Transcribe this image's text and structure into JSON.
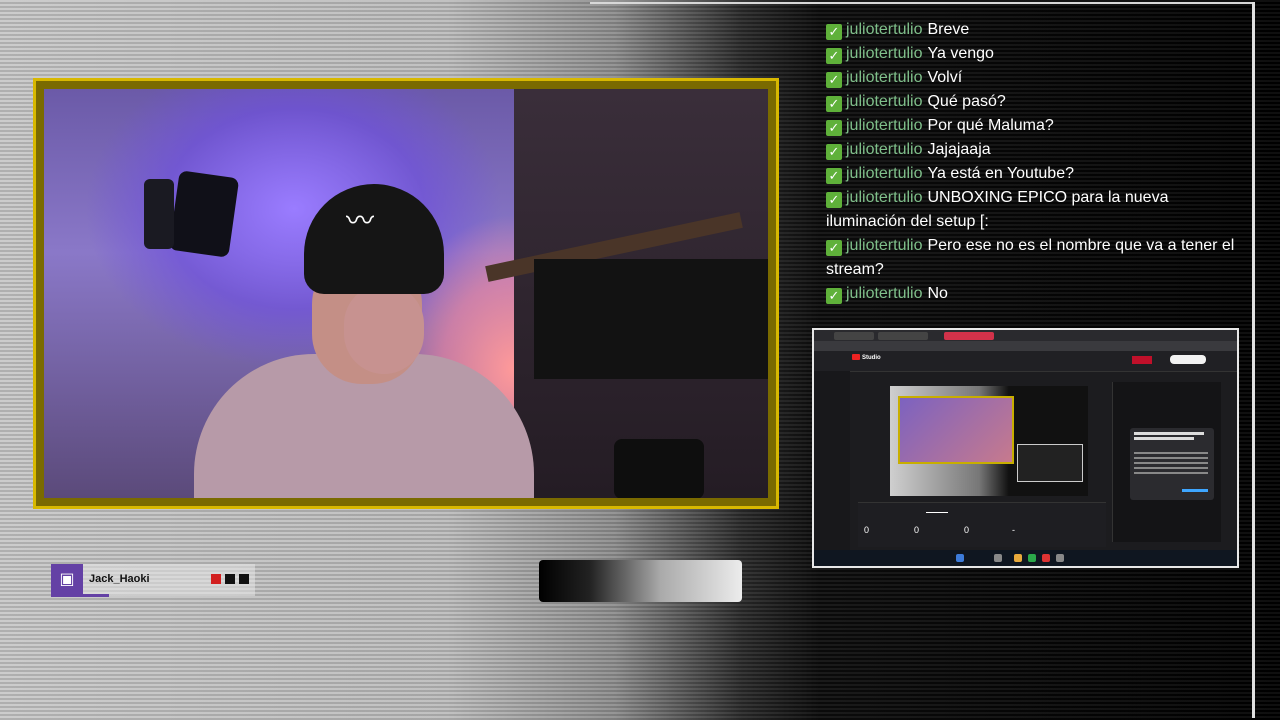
{
  "chat": {
    "messages": [
      {
        "user": "juliotertulio",
        "text": "Breve"
      },
      {
        "user": "juliotertulio",
        "text": "Ya vengo"
      },
      {
        "user": "juliotertulio",
        "text": "Volví"
      },
      {
        "user": "juliotertulio",
        "text": "Qué pasó?"
      },
      {
        "user": "juliotertulio",
        "text": "Por qué Maluma?"
      },
      {
        "user": "juliotertulio",
        "text": "Jajajaaja"
      },
      {
        "user": "juliotertulio",
        "text": "Ya está en Youtube?"
      },
      {
        "user": "juliotertulio",
        "text": "UNBOXING EPICO para la nueva iluminación del setup [:"
      },
      {
        "user": "juliotertulio",
        "text": "Pero ese no es el nombre que va a tener el stream?"
      },
      {
        "user": "juliotertulio",
        "text": "No"
      }
    ],
    "badge_icon": "check-mark-icon"
  },
  "streamer": {
    "name": "Jack_Haoki",
    "platform_icon": "twitch-icon",
    "indicator_colors": [
      "#d21f1f",
      "#111111",
      "#111111"
    ]
  },
  "screen_share": {
    "app_title": "Studio",
    "stats": [
      "0",
      "0",
      "0",
      "-"
    ]
  },
  "colors": {
    "cam_border": "#d8b800",
    "username": "#7fbf8a",
    "check": "#5fb13a",
    "twitch": "#6441a5"
  }
}
